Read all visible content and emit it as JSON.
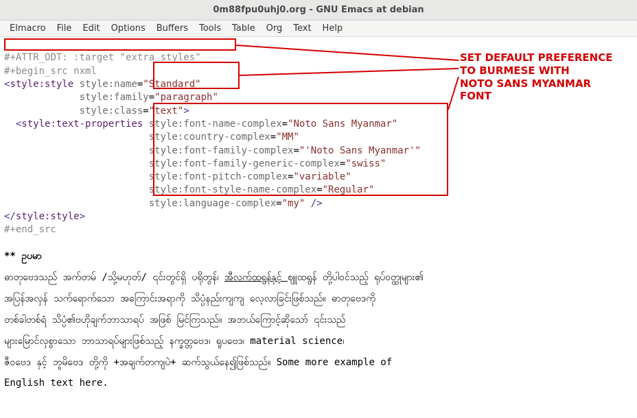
{
  "window": {
    "title": "0m88fpu0uhj0.org - GNU Emacs at debian"
  },
  "menu": {
    "items": [
      "Elmacro",
      "File",
      "Edit",
      "Options",
      "Buffers",
      "Tools",
      "Table",
      "Org",
      "Text",
      "Help"
    ]
  },
  "code": {
    "l1a": "#",
    "l1b": "+ATTR_ODT: :target \"extra_styles\"",
    "l2": "#+begin_src nxml",
    "l3_open": "<",
    "l3_tag": "style:style",
    "l3_sp": " ",
    "l3_a1k": "style:name",
    "l3_a1e": "=",
    "l3_a1v": "\"Standard\"",
    "l4_pad": "             ",
    "l4_k": "style:family",
    "l4_e": "=",
    "l4_v": "\"paragraph\"",
    "l5_pad": "             ",
    "l5_k": "style:class",
    "l5_e": "=",
    "l5_v": "\"text\"",
    "l5_close": ">",
    "l6_pad": "  ",
    "l6_open": "<",
    "l6_tag": "style:text-properties",
    "l6_sp": " ",
    "l6_k": "style:font-name-complex",
    "l6_e": "=",
    "l6_v": "\"Noto Sans Myanmar\"",
    "l7_pad": "                         ",
    "l7_k": "style:country-complex",
    "l7_e": "=",
    "l7_v": "\"MM\"",
    "l8_pad": "                         ",
    "l8_k": "style:font-family-complex",
    "l8_e": "=",
    "l8_v": "\"'Noto Sans Myanmar'\"",
    "l9_pad": "                         ",
    "l9_k": "style:font-family-generic-complex",
    "l9_e": "=",
    "l9_v": "\"swiss\"",
    "l10_pad": "                         ",
    "l10_k": "style:font-pitch-complex",
    "l10_e": "=",
    "l10_v": "\"variable\"",
    "l11_pad": "                         ",
    "l11_k": "style:font-style-name-complex",
    "l11_e": "=",
    "l11_v": "\"Regular\"",
    "l12_pad": "                         ",
    "l12_k": "style:language-complex",
    "l12_e": "=",
    "l12_v": "\"my\"",
    "l12_close": " />",
    "l13_open": "</",
    "l13_tag": "style:style",
    "l13_close": ">",
    "l14": "#+end_src"
  },
  "heading": "** ဥပမာ",
  "body": {
    "p1a": "ဓာတုဗေဒသည် အက်တမ် /သို့မဟုတ်/ ၎င်းတွင်ရှိ ပရိုတွန်၊ ",
    "p1u": " အီလက်ထရွန်နှင့် ",
    "p1b": " ဈူထရွန် တို့ပါဝင်သည့် ရုပ်ဝတ္ထုများ၏",
    "p2": "အပြန်အလှန် သက်ရောက်သော အကြောင်းအရာကို သိပ္ပံနည်းကျကျ လေ့လာခြင်းဖြစ်သည်။ ဓာတုဗေဒကို",
    "p3": "တစ်ခါတစ်ရံ သိပ္ပံ၏ဗဟိုချက်ဘာသာရပ် အဖြစ် မြင်ကြသည်။ အဘယ်ကြောင့်ဆိုသော် ၎င်းသည်",
    "p4": "များမြောင်လှစွာသော ဘာသာရပ်များဖြစ်သည့် နက္ခတ္တဗေဒ၊ ရူပဗေဒ၊ material science၊",
    "p5": "ဇီဝဗေဒ နှင့် ဘူမိဗေဒ တို့ကို +အချက်တကျပဲ+ ဆက်သွယ်နေ၍ဖြစ်သည်။ Some more example of",
    "p6": "English text here."
  },
  "annotation": {
    "l1": "SET DEFAULT PREFERENCE",
    "l2": "TO BURMESE WITH",
    "l3": "NOTO SANS MYANMAR",
    "l4": "FONT"
  }
}
